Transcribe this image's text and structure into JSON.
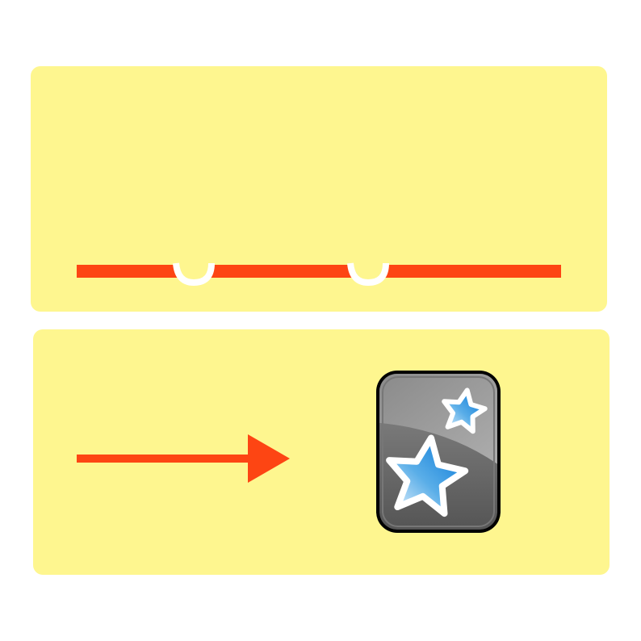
{
  "colors": {
    "panel": "#fef68f",
    "accent": "#fd4513",
    "card_dark": "#555555",
    "card_border": "#000000",
    "star_blue": "#0a7ed8",
    "star_light": "#e8f4fc"
  },
  "icons": {
    "top_panel": "dashed-line-icon",
    "bottom_arrow": "arrow-right-icon",
    "app": "anki-card-stars-icon"
  }
}
